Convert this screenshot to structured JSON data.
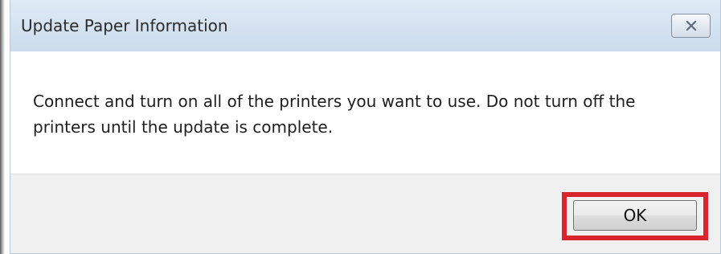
{
  "window": {
    "title": "Update Paper Information",
    "close_icon": "close-x-icon"
  },
  "content": {
    "message": "Connect and turn on all of the printers you want to use. Do not turn off the printers until the update is complete."
  },
  "footer": {
    "ok_label": "OK"
  },
  "colors": {
    "title_bar": "#d3e1f0",
    "highlight": "#d9242b",
    "footer_bg": "#f0f0f0"
  }
}
